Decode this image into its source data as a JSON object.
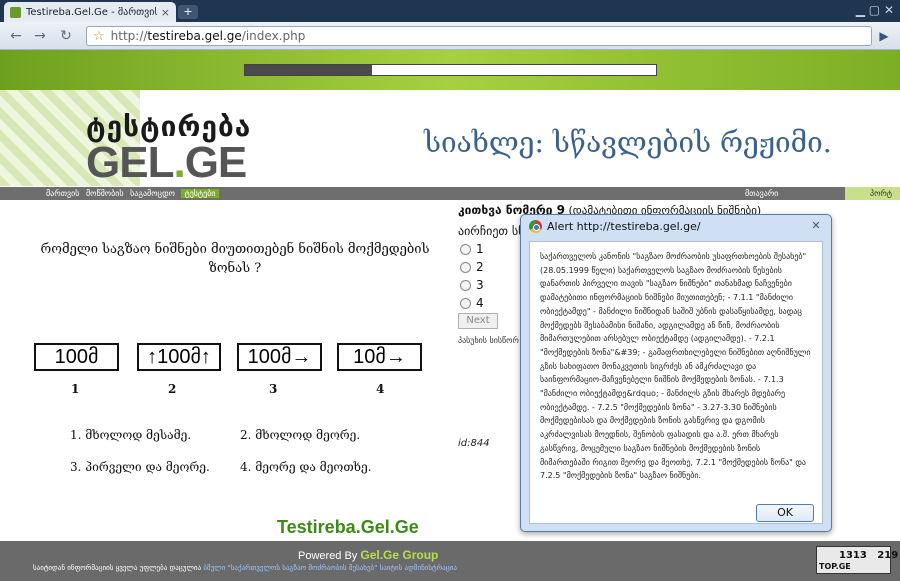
{
  "browser": {
    "tab_title": "Testireba.Gel.Ge - მართვის...",
    "tab_close": "×",
    "new_tab": "+",
    "url_prefix": "http://",
    "url_host": "testireba.gel.ge",
    "url_path": "/index.php"
  },
  "page": {
    "progress_fraction": 0.31,
    "logo_top": "ტესტირება",
    "logo_main": "GEL",
    "logo_dot": ".",
    "logo_tld": "GE",
    "news": "სიახლე: სწავლების რეჟიმი.",
    "nav": {
      "item1": "მართვის",
      "item2": "მოწმობის",
      "item3": "საგამოცდო",
      "item4": "ტესტები",
      "right1": "მთავარი",
      "right2": "პორტ"
    }
  },
  "quiz": {
    "question": "რომელი საგზაო ნიშნები მიუთითებენ ნიშნის მოქმედების ზონას ?",
    "signs": [
      "100მ",
      "↑100მ↑",
      "100მ→",
      "10მ→"
    ],
    "sign_numbers": [
      "1",
      "2",
      "3",
      "4"
    ],
    "answers": [
      "1. მხოლოდ მესამე.",
      "2. მხოლოდ მეორე.",
      "3. პირველი და მეორე.",
      "4. მეორე და მეოთხე."
    ],
    "title_prefix": "კითხვა ნომერი 9",
    "title_suffix": "(დამატებითი ინფორმაციის ნიშნები)",
    "choose_label": "აირჩიეთ სწ",
    "options": [
      "1",
      "2",
      "3",
      "4"
    ],
    "next_label": "Next",
    "answered_label": "პასუხის სისწორ",
    "id_label": "id:844"
  },
  "footer": {
    "brand": "Testireba.Gel.Ge",
    "powered_by": "Powered By",
    "group": "Gel.Ge Group",
    "copy_text": "საიტიდან ინფორმაციის ყველა უფლება დაცულია",
    "copy_link": "ბმული \"საქართველოს საგზაო მოძრაობის შესახებ\" საიტის ადმინისტრაცია",
    "counter_a": "1313",
    "counter_b": "219",
    "counter_label": "TOP.GE"
  },
  "alert": {
    "title": "Alert http://testireba.gel.ge/",
    "message": "საქართველოს კანონის \"საგზაო მოძრაობის უსაფრთხოების შესახებ\" (28.05.1999 წელი) საქართველოს საგზაო მოძრაობის წესების დანართის პირველი თავის \"საგზაო ნიშნები\" თანახმად ნაჩვენები დამატებითი ინფორმაციის ნიშნები მიუთითებენ;  - 7.1.1 \"მანძილი ობიექტამდე\"  - მანძილი ნიშნიდან საშიშ უბნის დასაწყისამდე, სადაც მოქმედებს შესაბამისი ნიშანი, ადგილამდე ან წინ, მოძრაობის მიმართულებით არსებულ ობიექტამდე (ადგილამდე).  - 7.2.1 \"მოქმედების ზონა\"&#39; - გამაფრთხილებელი ნიშნებით აღნიშნული გზის სახიფათო მონაკვეთის სიგრძეს ან ამკრძალავი და საინფორმაციო-მაჩვენებელი ნიშნის მოქმედების ზონას.  - 7.1.3 \"მანძილი ობიექტამდე&rdquo; - მანძილს გზის მხარეს მდებარე ობიექტამდე.  - 7.2.5 \"მოქმედების ზონა\" - 3.27-3.30 ნიშნების მოქმედებისას და მოქმედების ზონის გასწვრივ და დგომის აკრძალვისას მოედნის, შენობის ფასადის და ა.შ. ერთ მხარეს გასწვრივ, მოცემული საგზაო ნიშნების მოქმედების ზონის მიმართებაში რიგით მეორე და მეოთხე, 7.2.1 \"მოქმედების ზონა\" და 7.2.5 \"მოქმედების ზონა\" საგზაო ნიშნები.",
    "ok_label": "OK"
  }
}
